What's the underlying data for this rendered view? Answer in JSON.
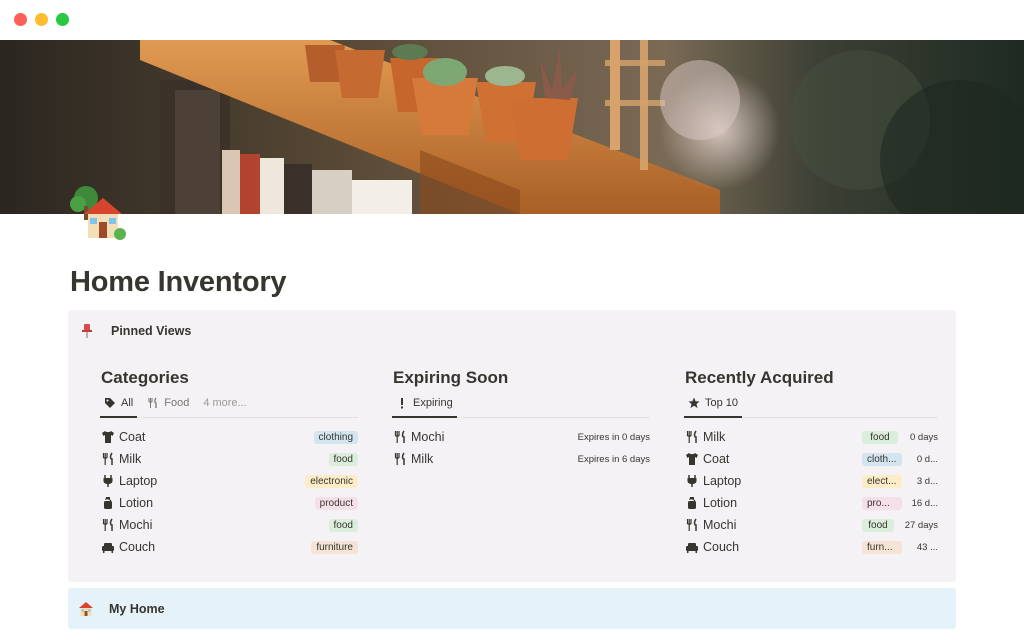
{
  "window": {
    "controls": [
      "close",
      "minimize",
      "maximize"
    ]
  },
  "page": {
    "title": "Home Inventory",
    "icon": "house-with-garden-icon"
  },
  "pinned": {
    "label": "Pinned Views",
    "icon": "pushpin-icon"
  },
  "categories": {
    "title": "Categories",
    "tabs": [
      {
        "label": "All",
        "icon": "tag-icon",
        "active": true
      },
      {
        "label": "Food",
        "icon": "fork-knife-icon",
        "active": false
      },
      {
        "label": "4 more...",
        "icon": "",
        "active": false
      }
    ],
    "rows": [
      {
        "name": "Coat",
        "icon": "shirt-icon",
        "tag": "clothing"
      },
      {
        "name": "Milk",
        "icon": "fork-knife-icon",
        "tag": "food"
      },
      {
        "name": "Laptop",
        "icon": "plug-icon",
        "tag": "electronic"
      },
      {
        "name": "Lotion",
        "icon": "bottle-icon",
        "tag": "product"
      },
      {
        "name": "Mochi",
        "icon": "fork-knife-icon",
        "tag": "food"
      },
      {
        "name": "Couch",
        "icon": "couch-icon",
        "tag": "furniture"
      }
    ]
  },
  "expiring": {
    "title": "Expiring Soon",
    "tabs": [
      {
        "label": "Expiring",
        "icon": "exclamation-icon",
        "active": true
      }
    ],
    "rows": [
      {
        "name": "Mochi",
        "icon": "fork-knife-icon",
        "meta": "Expires in 0 days"
      },
      {
        "name": "Milk",
        "icon": "fork-knife-icon",
        "meta": "Expires in 6 days"
      }
    ]
  },
  "recent": {
    "title": "Recently Acquired",
    "tabs": [
      {
        "label": "Top 10",
        "icon": "star-icon",
        "active": true
      }
    ],
    "rows": [
      {
        "name": "Milk",
        "icon": "fork-knife-icon",
        "tag": "food",
        "meta": "0 days"
      },
      {
        "name": "Coat",
        "icon": "shirt-icon",
        "tag": "cloth...",
        "meta": "0 d..."
      },
      {
        "name": "Laptop",
        "icon": "plug-icon",
        "tag": "elect...",
        "meta": "3 d..."
      },
      {
        "name": "Lotion",
        "icon": "bottle-icon",
        "tag": "pro...",
        "meta": "16 d..."
      },
      {
        "name": "Mochi",
        "icon": "fork-knife-icon",
        "tag": "food",
        "meta": "27 days"
      },
      {
        "name": "Couch",
        "icon": "couch-icon",
        "tag": "furn...",
        "meta": "43 ..."
      }
    ]
  },
  "myhome": {
    "label": "My Home",
    "icon": "house-icon"
  },
  "colors": {
    "clothing": "#d3e5ef",
    "food": "#dbeddb",
    "electronic": "#fdecc8",
    "product": "#f5e0e9",
    "furniture": "#f5e3d6",
    "callout": "#f4f2f5",
    "myhome": "#e5f2f9"
  }
}
